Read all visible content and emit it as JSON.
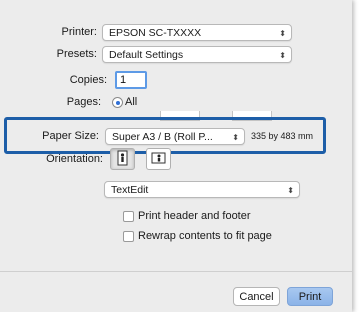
{
  "printer": {
    "label": "Printer:",
    "value": "EPSON SC-TXXXX"
  },
  "presets": {
    "label": "Presets:",
    "value": "Default Settings"
  },
  "copies": {
    "label": "Copies:",
    "value": "1"
  },
  "pages": {
    "label": "Pages:",
    "all_label": "All"
  },
  "paper_size": {
    "label": "Paper Size:",
    "value": "Super A3 / B (Roll P...",
    "dimensions": "335 by 483 mm"
  },
  "orientation": {
    "label": "Orientation:"
  },
  "app_menu": {
    "value": "TextEdit"
  },
  "options": {
    "print_header": "Print header and footer",
    "rewrap": "Rewrap contents to fit page"
  },
  "buttons": {
    "cancel": "Cancel",
    "print": "Print"
  },
  "colors": {
    "highlight": "#1d5ea8",
    "accent": "#5d9ae6",
    "dialog_bg": "#ececec"
  },
  "icons": {
    "popup_arrows": "up-down-chevron-icon",
    "portrait": "portrait-person-icon",
    "landscape": "landscape-person-icon"
  }
}
